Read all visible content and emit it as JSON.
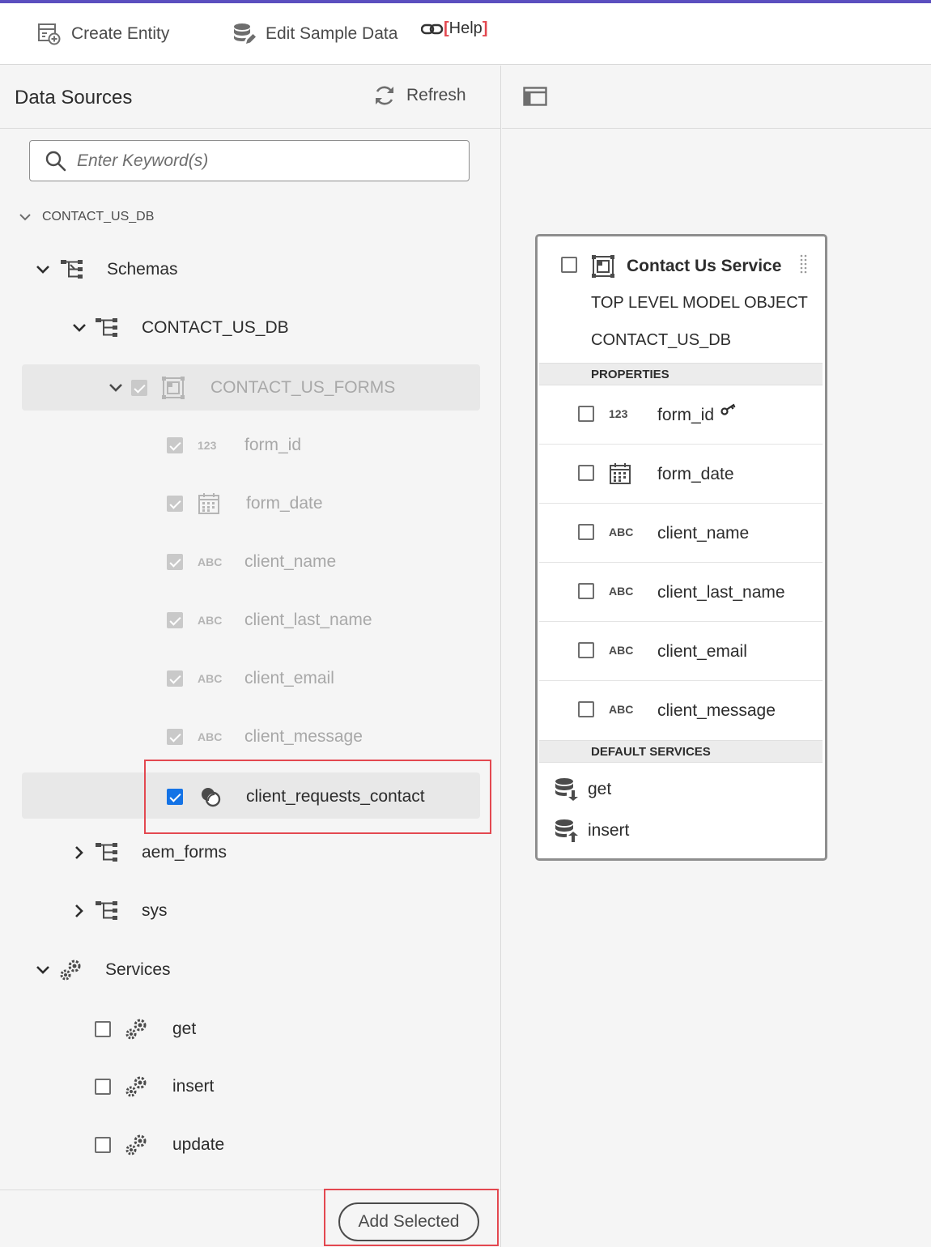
{
  "toolbar": {
    "create_entity": "Create Entity",
    "edit_sample_data": "Edit Sample Data",
    "help": "Help"
  },
  "left_panel": {
    "title": "Data Sources",
    "refresh": "Refresh",
    "search_placeholder": "Enter Keyword(s)",
    "root": "CONTACT_US_DB",
    "schemas": "Schemas",
    "schema_db": "CONTACT_US_DB",
    "table": "CONTACT_US_FORMS",
    "fields": [
      {
        "type": "123",
        "name": "form_id"
      },
      {
        "type": "calendar",
        "name": "form_date"
      },
      {
        "type": "ABC",
        "name": "client_name"
      },
      {
        "type": "ABC",
        "name": "client_last_name"
      },
      {
        "type": "ABC",
        "name": "client_email"
      },
      {
        "type": "ABC",
        "name": "client_message"
      }
    ],
    "association": "client_requests_contact",
    "other_schemas": [
      "aem_forms",
      "sys"
    ],
    "services_label": "Services",
    "services": [
      "get",
      "insert",
      "update"
    ],
    "add_selected": "Add Selected"
  },
  "card": {
    "title": "Contact Us Service",
    "subtitle1": "TOP LEVEL MODEL OBJECT",
    "subtitle2": "CONTACT_US_DB",
    "properties_header": "PROPERTIES",
    "properties": [
      {
        "type": "123",
        "name": "form_id",
        "key": true
      },
      {
        "type": "calendar",
        "name": "form_date"
      },
      {
        "type": "ABC",
        "name": "client_name"
      },
      {
        "type": "ABC",
        "name": "client_last_name"
      },
      {
        "type": "ABC",
        "name": "client_email"
      },
      {
        "type": "ABC",
        "name": "client_message"
      }
    ],
    "services_header": "DEFAULT SERVICES",
    "services": [
      "get",
      "insert"
    ]
  },
  "colors": {
    "accent": "#1473e6",
    "highlight": "#e34850",
    "topline": "#5b4fbf"
  }
}
